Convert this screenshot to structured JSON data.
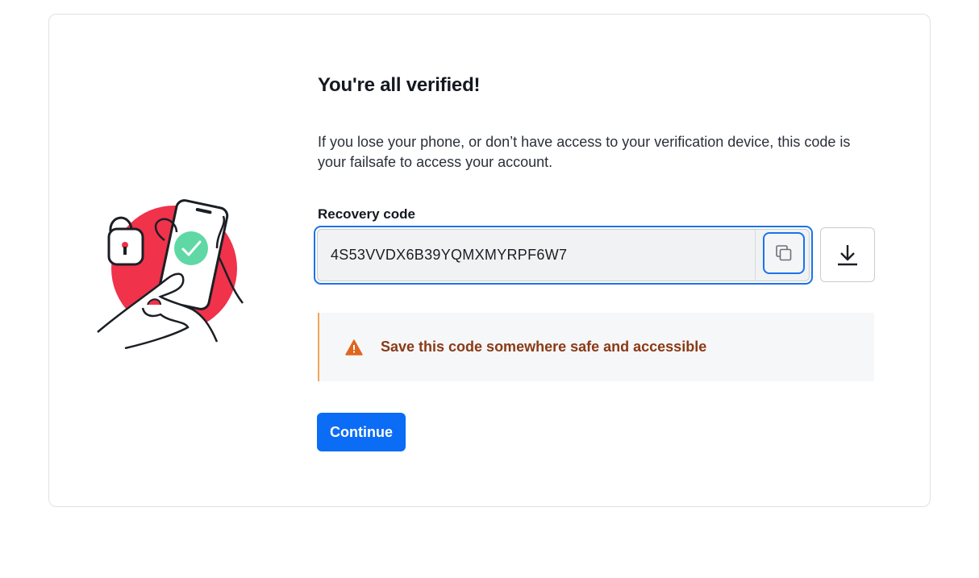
{
  "page": {
    "title": "You're all verified!",
    "description": "If you lose your phone, or don’t have access to your verification device, this code is your failsafe to access your account."
  },
  "recovery": {
    "label": "Recovery code",
    "code": "4S53VVDX6B39YQMXMYRPF6W7",
    "copy_icon": "copy-icon",
    "download_icon": "download-icon"
  },
  "alert": {
    "icon": "warning-icon",
    "text": "Save this code somewhere safe and accessible"
  },
  "actions": {
    "continue_label": "Continue"
  },
  "colors": {
    "accent": "#0b6cf5",
    "focus": "#1a73e8",
    "warning_text": "#8a3a16",
    "warning_icon": "#e0661f",
    "illustration_red": "#f0324b",
    "check_green": "#5fd8a6"
  }
}
